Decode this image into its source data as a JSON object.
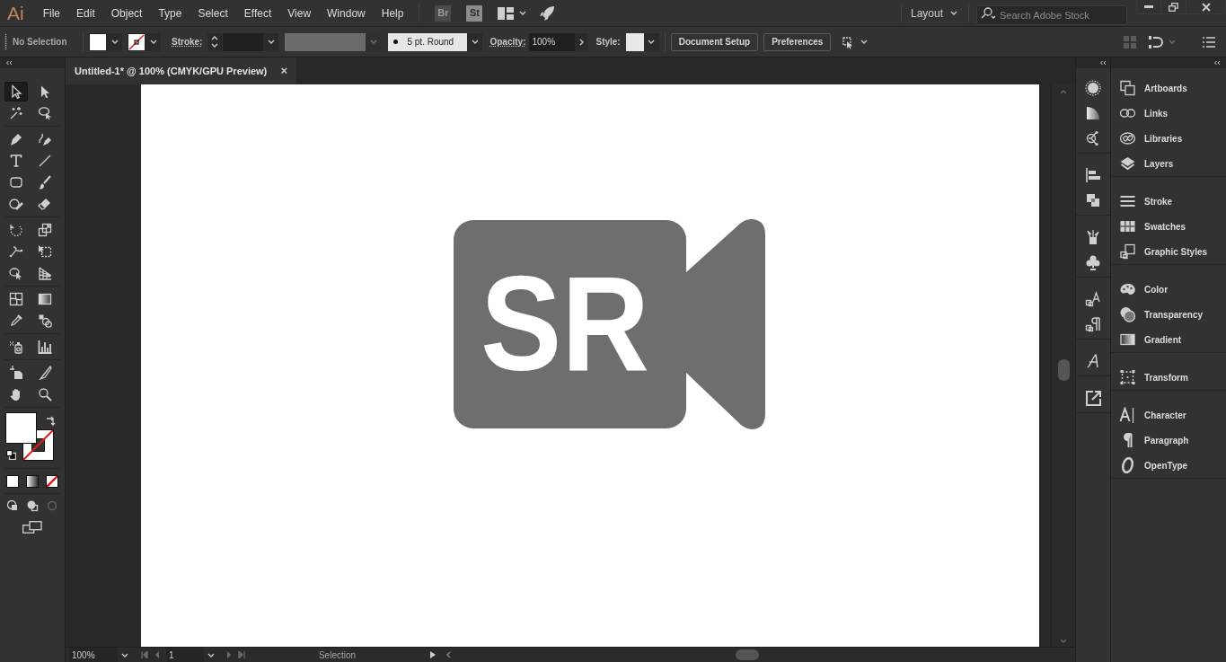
{
  "app_logo": "Ai",
  "menu": [
    "File",
    "Edit",
    "Object",
    "Type",
    "Select",
    "Effect",
    "View",
    "Window",
    "Help"
  ],
  "app_buttons": [
    "Br",
    "St"
  ],
  "workspace": {
    "label": "Layout"
  },
  "search": {
    "placeholder": "Search Adobe Stock"
  },
  "control_bar": {
    "selection": "No Selection",
    "stroke_label": "Stroke:",
    "brush": "5 pt. Round",
    "opacity_label": "Opacity:",
    "opacity": "100%",
    "style_label": "Style:",
    "buttons": [
      "Document Setup",
      "Preferences"
    ]
  },
  "document_tab": {
    "title": "Untitled-1* @ 100% (CMYK/GPU Preview)",
    "close": "×"
  },
  "tools": [
    {
      "selected": true
    },
    {
      "selected": false
    },
    {
      "selected": false
    },
    {
      "selected": false
    },
    {
      "selected": false
    },
    {
      "selected": false
    },
    {
      "selected": false
    },
    {
      "selected": false
    },
    {
      "selected": false
    },
    {
      "selected": false
    },
    {
      "selected": false
    },
    {
      "selected": false
    },
    {
      "selected": false
    },
    {
      "selected": false
    },
    {
      "selected": false
    },
    {
      "selected": false
    },
    {
      "selected": false
    },
    {
      "selected": false
    },
    {
      "selected": false
    },
    {
      "selected": false
    },
    {
      "selected": false
    },
    {
      "selected": false
    },
    {
      "selected": false
    },
    {
      "selected": false
    },
    {
      "selected": false
    },
    {
      "selected": false
    },
    {
      "selected": false
    },
    {
      "selected": false
    }
  ],
  "artwork": {
    "text": "SR"
  },
  "panel_groups": [
    {
      "items": [
        "Artboards",
        "Links",
        "Libraries",
        "Layers"
      ]
    },
    {
      "items": [
        "Stroke",
        "Swatches",
        "Graphic Styles"
      ]
    },
    {
      "items": [
        "Color",
        "Transparency",
        "Gradient"
      ]
    },
    {
      "items": [
        "Transform"
      ]
    },
    {
      "items": [
        "Character",
        "Paragraph",
        "OpenType"
      ]
    }
  ],
  "status_bar": {
    "zoom": "100%",
    "artboard": "1",
    "tool": "Selection"
  }
}
